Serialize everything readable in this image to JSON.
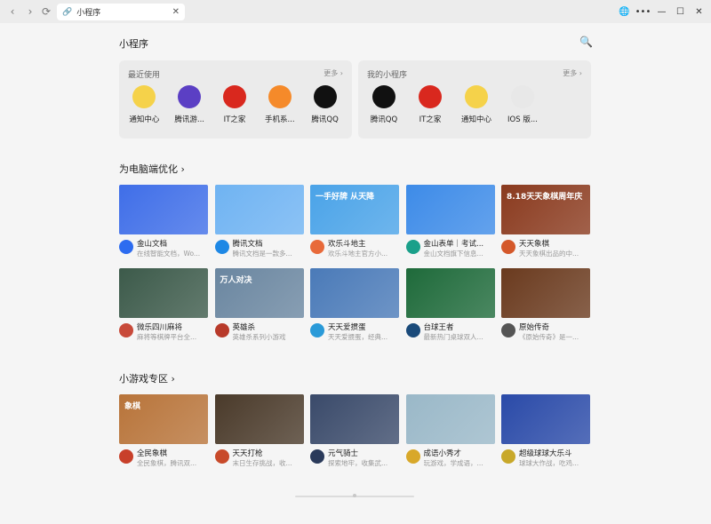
{
  "window": {
    "tab_title": "小程序",
    "controls": {
      "globe": "🌐",
      "more": "•••",
      "minimize": "—",
      "maximize": "☐",
      "close": "✕"
    }
  },
  "page": {
    "title": "小程序"
  },
  "recent": {
    "title": "最近使用",
    "more": "更多 ›",
    "items": [
      {
        "label": "通知中心",
        "icon": "bell-icon",
        "color": "#f5d24a"
      },
      {
        "label": "腾讯游...",
        "icon": "game-icon",
        "color": "#5b3fc4"
      },
      {
        "label": "IT之家",
        "icon": "it-icon",
        "color": "#d9281e"
      },
      {
        "label": "手机系...",
        "icon": "apple-icon",
        "color": "#f58a2a"
      },
      {
        "label": "腾讯QQ",
        "icon": "qq-icon",
        "color": "#111111"
      }
    ]
  },
  "mine": {
    "title": "我的小程序",
    "more": "更多 ›",
    "items": [
      {
        "label": "腾讯QQ",
        "icon": "qq-icon",
        "color": "#111111"
      },
      {
        "label": "IT之家",
        "icon": "it-icon",
        "color": "#d9281e"
      },
      {
        "label": "通知中心",
        "icon": "bell-icon",
        "color": "#f5d24a"
      },
      {
        "label": "IOS 版...",
        "icon": "ios-icon",
        "color": "#e8e8e8"
      }
    ]
  },
  "sections": {
    "pc": {
      "title": "为电脑端优化  ›",
      "cards": [
        {
          "name": "金山文档",
          "desc": "在线智能文档，Wo...",
          "thumb": "#3f6ee8",
          "ico": "#2d6cf0",
          "thumb_text": ""
        },
        {
          "name": "腾讯文档",
          "desc": "腾讯文档是一款多...",
          "thumb": "#6fb3f2",
          "ico": "#1e88e5",
          "thumb_text": ""
        },
        {
          "name": "欢乐斗地主",
          "desc": "欢乐斗地主官方小...",
          "thumb": "#4aa3e8",
          "ico": "#e86a3a",
          "thumb_text": "一手好牌 从天降"
        },
        {
          "name": "金山表单｜考试...",
          "desc": "金山文档旗下信息...",
          "thumb": "#3d8be8",
          "ico": "#1aa08a",
          "thumb_text": ""
        },
        {
          "name": "天天象棋",
          "desc": "天天象棋出品的中...",
          "thumb": "#8a3a1e",
          "ico": "#d4582a",
          "thumb_text": "8.18天天象棋周年庆"
        },
        {
          "name": "微乐四川麻将",
          "desc": "麻将等棋牌平台全...",
          "thumb": "#3c5a4a",
          "ico": "#c84a3a",
          "thumb_text": ""
        },
        {
          "name": "英雄杀",
          "desc": "英雄杀系列小游戏",
          "thumb": "#6a86a0",
          "ico": "#b83a2a",
          "thumb_text": "万人对决"
        },
        {
          "name": "天天爱掼蛋",
          "desc": "天天爱掼蛋，经典...",
          "thumb": "#4a7ab8",
          "ico": "#2a9ad8",
          "thumb_text": ""
        },
        {
          "name": "台球王者",
          "desc": "最新热门桌球双人...",
          "thumb": "#1e6a3a",
          "ico": "#1a4a7a",
          "thumb_text": ""
        },
        {
          "name": "原始传奇",
          "desc": "《原始传奇》是一...",
          "thumb": "#6a3a1e",
          "ico": "#555555",
          "thumb_text": ""
        }
      ]
    },
    "games": {
      "title": "小游戏专区  ›",
      "cards": [
        {
          "name": "全民象棋",
          "desc": "全民象棋，腾讯双...",
          "thumb": "#b8743a",
          "ico": "#c8402a",
          "thumb_text": "象棋"
        },
        {
          "name": "天天打枪",
          "desc": "末日生存挑战，收...",
          "thumb": "#4a3a2a",
          "ico": "#c84a2a",
          "thumb_text": ""
        },
        {
          "name": "元气骑士",
          "desc": "探索地牢，收集武...",
          "thumb": "#3a4a6a",
          "ico": "#2a3a5a",
          "thumb_text": ""
        },
        {
          "name": "成语小秀才",
          "desc": "玩游戏，学成语，...",
          "thumb": "#9ab8c8",
          "ico": "#d8a82a",
          "thumb_text": ""
        },
        {
          "name": "超级球球大乐斗",
          "desc": "球球大作战，吃鸡...",
          "thumb": "#2a4aa8",
          "ico": "#c8a82a",
          "thumb_text": ""
        }
      ]
    }
  }
}
